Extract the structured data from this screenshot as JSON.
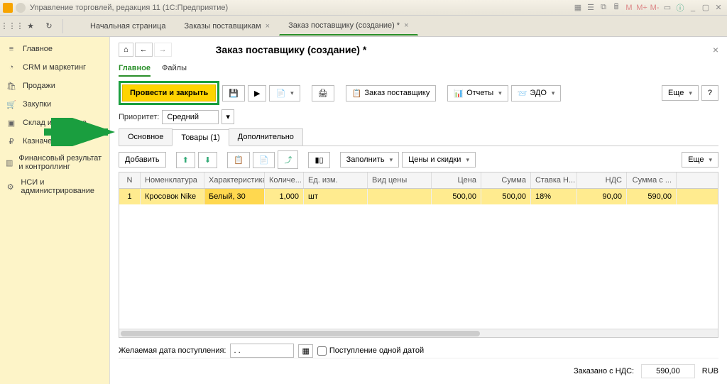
{
  "window": {
    "title": "Управление торговлей, редакция 11  (1С:Предприятие)"
  },
  "tabs": {
    "home": "Начальная страница",
    "orders": "Заказы поставщикам",
    "order_create": "Заказ поставщику (создание) *"
  },
  "sidebar": {
    "main": "Главное",
    "crm": "CRM и маркетинг",
    "sales": "Продажи",
    "purchases": "Закупки",
    "warehouse": "Склад и доставка",
    "treasury": "Казначейство",
    "finresult": "Финансовый результат и контроллинг",
    "nsi": "НСИ и администрирование"
  },
  "doc": {
    "title": "Заказ поставщику (создание) *",
    "subtabs": {
      "main": "Главное",
      "files": "Файлы"
    },
    "toolbar": {
      "submit": "Провести и закрыть",
      "order_supplier": "Заказ поставщику",
      "reports": "Отчеты",
      "edo": "ЭДО",
      "more": "Еще"
    },
    "priority_label": "Приоритет:",
    "priority_value": "Средний",
    "subtabs2": {
      "basic": "Основное",
      "goods": "Товары (1)",
      "extra": "Дополнительно"
    },
    "goods_toolbar": {
      "add": "Добавить",
      "fill": "Заполнить",
      "prices": "Цены и скидки",
      "more": "Еще"
    },
    "table": {
      "headers": {
        "n": "N",
        "nom": "Номенклатура",
        "char": "Характеристика",
        "qty": "Количе...",
        "unit": "Ед. изм.",
        "price_type": "Вид цены",
        "price": "Цена",
        "sum": "Сумма",
        "vat_rate": "Ставка Н...",
        "vat": "НДС",
        "sum_vat": "Сумма с ..."
      },
      "row": {
        "n": "1",
        "nom": "Кросовок Nike",
        "char": "Белый, 30",
        "qty": "1,000",
        "unit": "шт",
        "price_type": "",
        "price": "500,00",
        "sum": "500,00",
        "vat_rate": "18%",
        "vat": "90,00",
        "sum_vat": "590,00"
      }
    },
    "desired_date_label": "Желаемая дата поступления:",
    "desired_date_value": ". .",
    "single_date_checkbox": "Поступление одной датой",
    "footer": {
      "total_label": "Заказано с НДС:",
      "total_value": "590,00",
      "currency": "RUB"
    }
  }
}
